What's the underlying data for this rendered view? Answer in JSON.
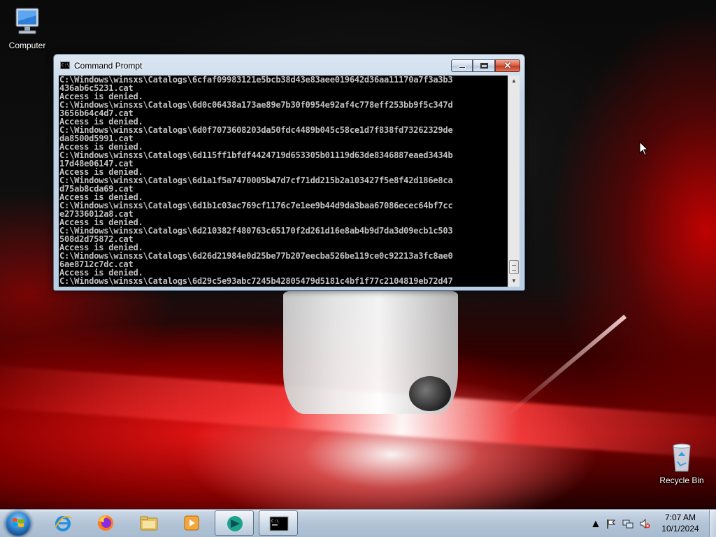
{
  "desktop": {
    "icons": [
      {
        "label": "Computer"
      },
      {
        "label": "Recycle Bin"
      }
    ]
  },
  "cmd_window": {
    "title": "Command Prompt",
    "lines": [
      "C:\\Windows\\winsxs\\Catalogs\\6cfaf09983121e5bcb38d43e83aee019642d36aa11170a7f3a3b3",
      "436ab6c5231.cat",
      "Access is denied.",
      "C:\\Windows\\winsxs\\Catalogs\\6d0c06438a173ae89e7b30f0954e92af4c778eff253bb9f5c347d",
      "3656b64c4d7.cat",
      "Access is denied.",
      "C:\\Windows\\winsxs\\Catalogs\\6d0f7073608203da50fdc4489b045c58ce1d7f838fd73262329de",
      "da8500d5991.cat",
      "Access is denied.",
      "C:\\Windows\\winsxs\\Catalogs\\6d115ff1bfdf4424719d653305b01119d63de8346887eaed3434b",
      "17d48e06147.cat",
      "Access is denied.",
      "C:\\Windows\\winsxs\\Catalogs\\6d1a1f5a7470005b47d7cf71dd215b2a103427f5e8f42d186e8ca",
      "d75ab8cda69.cat",
      "Access is denied.",
      "C:\\Windows\\winsxs\\Catalogs\\6d1b1c03ac769cf1176c7e1ee9b44d9da3baa67086ecec64bf7cc",
      "e27336012a8.cat",
      "Access is denied.",
      "C:\\Windows\\winsxs\\Catalogs\\6d210382f480763c65170f2d261d16e8ab4b9d7da3d09ecb1c503",
      "508d2d75872.cat",
      "Access is denied.",
      "C:\\Windows\\winsxs\\Catalogs\\6d26d21984e0d25be77b207eecba526be119ce0c92213a3fc8ae0",
      "6ae8712c7dc.cat",
      "Access is denied.",
      "C:\\Windows\\winsxs\\Catalogs\\6d29c5e93abc7245b42805479d5181c4bf1f77c2104819eb72d47"
    ]
  },
  "taskbar": {
    "pinned": [
      {
        "icon": "internet-explorer-icon"
      },
      {
        "icon": "firefox-icon"
      },
      {
        "icon": "file-explorer-icon"
      },
      {
        "icon": "media-player-icon"
      },
      {
        "icon": "app-icon"
      },
      {
        "icon": "command-prompt-icon"
      }
    ],
    "clock": {
      "time": "7:07 AM",
      "date": "10/1/2024"
    }
  },
  "colors": {
    "console_bg": "#000000",
    "console_text": "#c0c0c0",
    "taskbar": "#b3c4d7"
  }
}
